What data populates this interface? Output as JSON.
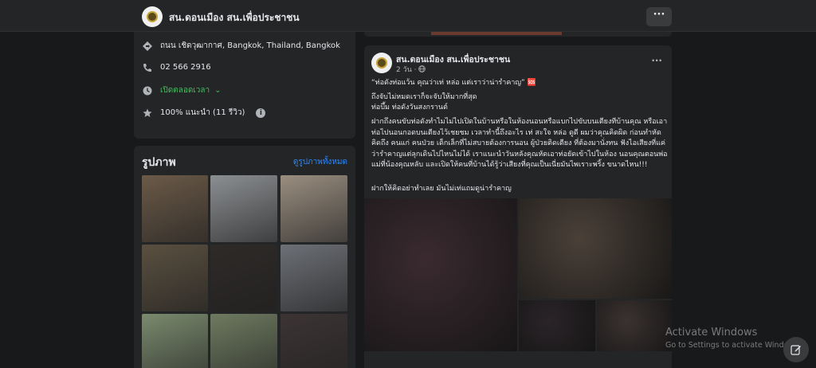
{
  "header": {
    "page_name": "สน.ดอนเมือง สน.เพื่อประชาชน",
    "more_label": "···"
  },
  "intro": {
    "address": "ถนน เชิดวุฒากาศ, Bangkok, Thailand, Bangkok",
    "phone": "02 566 2916",
    "hours": "เปิดตลอดเวลา",
    "hours_caret": "⌄",
    "rating": "100% แนะนำ (11 รีวิว)",
    "info_glyph": "i",
    "icons": [
      "location-icon",
      "phone-icon",
      "clock-icon",
      "star-icon",
      "info-icon"
    ]
  },
  "photos": {
    "title": "รูปภาพ",
    "see_all": "ดูรูปภาพทั้งหมด",
    "tiles": [
      {
        "desc": "officer-standing",
        "color": "#6b5a48"
      },
      {
        "desc": "motorcycles-parked",
        "color": "#8c8f92"
      },
      {
        "desc": "street-checkpoint",
        "color": "#9a8e80"
      },
      {
        "desc": "officers-night",
        "color": "#5a5040"
      },
      {
        "desc": "night-motorbike",
        "color": "#2e2a28"
      },
      {
        "desc": "seized-bikes",
        "color": "#6d7076"
      },
      {
        "desc": "officers-group",
        "color": "#7a8a6e"
      },
      {
        "desc": "roadside-group",
        "color": "#6e7a60"
      },
      {
        "desc": "night-street",
        "color": "#3c3434"
      }
    ]
  },
  "post": {
    "author": "สน.ดอนเมือง สน.เพื่อประชาชน",
    "time": "2 วัน",
    "privacy_icon": "globe-icon",
    "more_label": "···",
    "p1": "“ท่อดังท่อแว้น คุณว่าเท่ หล่อ แต่เราว่าน่ารำคาญ” 🆘",
    "p2_line1": "ถึงจับไม่หมดเราก็จะจับให้มากที่สุด",
    "p2_line2": "ท่อบึ้ม ท่อดังวันสงกรานต์",
    "p3": "ฝากถึงคนขับท่อดังทำไมไม่ไปเปิดในบ้านหรือในห้องนอนหรือแบกไปขับบนเตียงที่บ้านคุณ หรือเอาท่อไปนอนกอดบนเตียงไว้เชยชม เวลาทำนี้ถึงอะไร เท่ สะใจ หล่อ ดูดี ผมว่าคุณคิดผิด ก่อนทำหัดคิดถึง คนแก่ คนป่วย เด็กเล็กที่ไม่สบายต้องการนอน ผู้ป่วยติดเตียง ที่ต้องมานั่งทน ฟังไอเสียงที่แค่ว่ารำคาญแต่ลุกเดินไปไหนไม่ได้ เราแนะนำวันหลังคุณหัดเอาท่อยัดเข้าไปในห้อง นอนคุณตอนพ่อแม่ที่น้องคุณหลับ และเปิดให้คนที่บ้านได้รู้ว่าเสียงที่คุณเป็นเนี่ยมันไพเราะพริ้ง ขนาดไหน!!!",
    "p4": "ฝากให้คิดอย่าทำเลย มันไม่เท่แถมดูน่ารำคาญ",
    "images": [
      {
        "desc": "officer-with-red-scooter",
        "color": "#3a2a30"
      },
      {
        "desc": "officers-checking-bikes",
        "color": "#4a4038"
      },
      {
        "desc": "night-checkpoint-crowd",
        "color": "#2a2428"
      },
      {
        "desc": "officers-group-night",
        "color": "#3a3230"
      }
    ]
  },
  "os_watermark": {
    "line1": "Activate Windows",
    "line2": "Go to Settings to activate Windows."
  },
  "fab_icon": "edit-icon"
}
